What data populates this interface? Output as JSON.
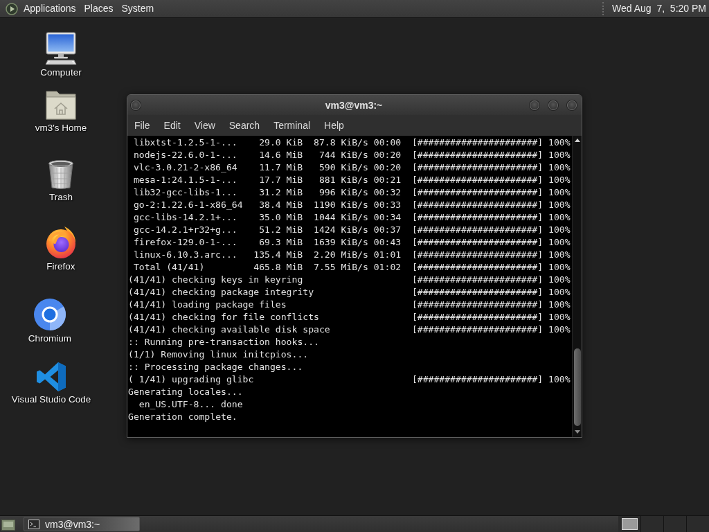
{
  "top_panel": {
    "menus": [
      "Applications",
      "Places",
      "System"
    ],
    "clock": "Wed Aug  7,  5:20 PM"
  },
  "desktop_icons": [
    {
      "label": "Computer"
    },
    {
      "label": "vm3's Home"
    },
    {
      "label": "Trash"
    },
    {
      "label": "Firefox"
    },
    {
      "label": "Chromium"
    },
    {
      "label": "Visual Studio Code"
    }
  ],
  "terminal": {
    "title": "vm3@vm3:~",
    "menu": [
      "File",
      "Edit",
      "View",
      "Search",
      "Terminal",
      "Help"
    ],
    "lines": [
      {
        "kind": "download",
        "name": "libxtst-1.2.5-1-...",
        "size": "29.0 KiB",
        "rate": "87.8 KiB/s",
        "eta": "00:00",
        "bar": "[######################]",
        "percent": "100%"
      },
      {
        "kind": "download",
        "name": "nodejs-22.6.0-1-...",
        "size": "14.6 MiB",
        "rate": "744 KiB/s",
        "eta": "00:20",
        "bar": "[######################]",
        "percent": "100%"
      },
      {
        "kind": "download",
        "name": "vlc-3.0.21-2-x86_64",
        "size": "11.7 MiB",
        "rate": "590 KiB/s",
        "eta": "00:20",
        "bar": "[######################]",
        "percent": "100%"
      },
      {
        "kind": "download",
        "name": "mesa-1:24.1.5-1-...",
        "size": "17.7 MiB",
        "rate": "881 KiB/s",
        "eta": "00:21",
        "bar": "[######################]",
        "percent": "100%"
      },
      {
        "kind": "download",
        "name": "lib32-gcc-libs-1...",
        "size": "31.2 MiB",
        "rate": "996 KiB/s",
        "eta": "00:32",
        "bar": "[######################]",
        "percent": "100%"
      },
      {
        "kind": "download",
        "name": "go-2:1.22.6-1-x86_64",
        "size": "38.4 MiB",
        "rate": "1190 KiB/s",
        "eta": "00:33",
        "bar": "[######################]",
        "percent": "100%"
      },
      {
        "kind": "download",
        "name": "gcc-libs-14.2.1+...",
        "size": "35.0 MiB",
        "rate": "1044 KiB/s",
        "eta": "00:34",
        "bar": "[######################]",
        "percent": "100%"
      },
      {
        "kind": "download",
        "name": "gcc-14.2.1+r32+g...",
        "size": "51.2 MiB",
        "rate": "1424 KiB/s",
        "eta": "00:37",
        "bar": "[######################]",
        "percent": "100%"
      },
      {
        "kind": "download",
        "name": "firefox-129.0-1-...",
        "size": "69.3 MiB",
        "rate": "1639 KiB/s",
        "eta": "00:43",
        "bar": "[######################]",
        "percent": "100%"
      },
      {
        "kind": "download",
        "name": "linux-6.10.3.arc...",
        "size": "135.4 MiB",
        "rate": "2.20 MiB/s",
        "eta": "01:01",
        "bar": "[######################]",
        "percent": "100%"
      },
      {
        "kind": "download",
        "name": "Total (41/41)",
        "size": "465.8 MiB",
        "rate": "7.55 MiB/s",
        "eta": "01:02",
        "bar": "[######################]",
        "percent": "100%"
      },
      {
        "kind": "step",
        "text": "(41/41) checking keys in keyring",
        "bar": "[######################]",
        "percent": "100%"
      },
      {
        "kind": "step",
        "text": "(41/41) checking package integrity",
        "bar": "[######################]",
        "percent": "100%"
      },
      {
        "kind": "step",
        "text": "(41/41) loading package files",
        "bar": "[######################]",
        "percent": "100%"
      },
      {
        "kind": "step",
        "text": "(41/41) checking for file conflicts",
        "bar": "[######################]",
        "percent": "100%"
      },
      {
        "kind": "step",
        "text": "(41/41) checking available disk space",
        "bar": "[######################]",
        "percent": "100%"
      },
      {
        "kind": "text",
        "text": ":: Running pre-transaction hooks..."
      },
      {
        "kind": "text",
        "text": "(1/1) Removing linux initcpios..."
      },
      {
        "kind": "text",
        "text": ":: Processing package changes..."
      },
      {
        "kind": "step",
        "text": "( 1/41) upgrading glibc",
        "bar": "[######################]",
        "percent": "100%"
      },
      {
        "kind": "text",
        "text": "Generating locales...",
        "children": [
          {
            "kind": "text",
            "text": "en_US.UTF-8... done"
          }
        ]
      },
      {
        "kind": "text",
        "text": "Generation complete."
      }
    ]
  },
  "taskbar": {
    "tasks": [
      {
        "label": "vm3@vm3:~",
        "selected": true
      }
    ]
  }
}
